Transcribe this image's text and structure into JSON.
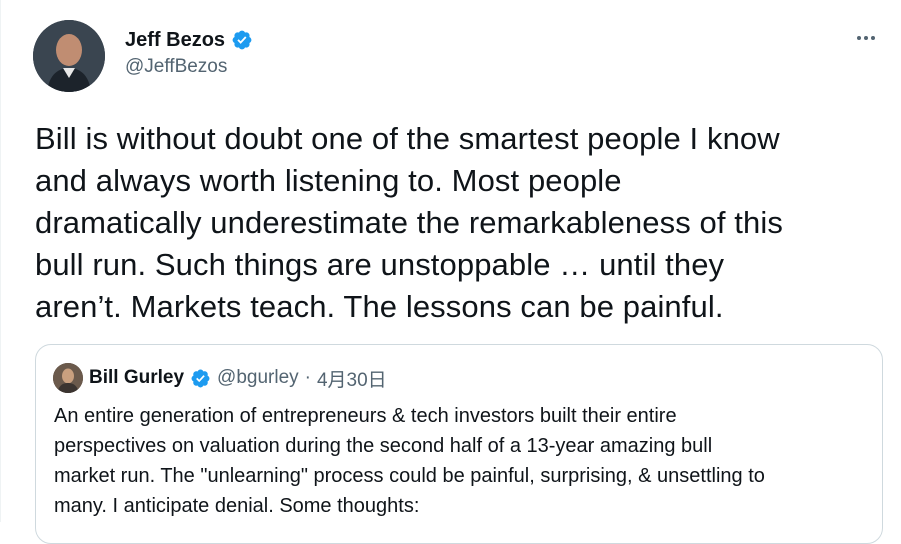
{
  "author": {
    "name": "Jeff Bezos",
    "handle": "@JeffBezos",
    "avatar_icon": "profile-photo-icon",
    "verified_icon": "verified-badge-icon"
  },
  "more_icon": "more-options-icon",
  "tweet": {
    "text": "Bill is without doubt one of the smartest people I know\nand always worth listening to. Most people\ndramatically underestimate the remarkableness of this\nbull run. Such things are unstoppable … until they\naren’t.  Markets teach. The lessons can be painful."
  },
  "quoted_tweet": {
    "name": "Bill Gurley",
    "handle": "@bgurley",
    "separator": "·",
    "date": "4月30日",
    "text": "An entire generation of entrepreneurs & tech investors built their entire\nperspectives on valuation during the second  half of a 13-year amazing bull\nmarket run. The \"unlearning\" process could be painful, surprising, & unsettling to\nmany. I anticipate denial. Some thoughts:"
  },
  "colors": {
    "verified": "#1d9bf0",
    "secondary_text": "#536471",
    "border": "#cfd9de"
  }
}
